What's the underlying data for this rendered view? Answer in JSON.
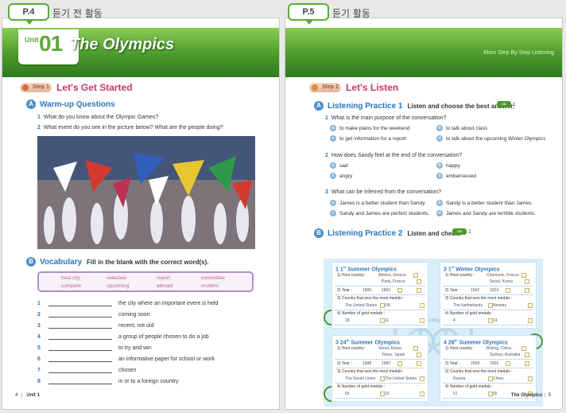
{
  "left_page": {
    "tab": "P.4",
    "tab_title": "듣기 전 활동",
    "unit_label": "Unit",
    "unit_number": "01",
    "unit_title": "The Olympics",
    "step_label": "Step 1",
    "step_title": "Let's Get Started",
    "warmup_title": "Warm-up Questions",
    "warmup_icon": "A",
    "questions": [
      {
        "num": "1",
        "text": "What do you know about the Olympic Games?"
      },
      {
        "num": "2",
        "text": "What event do you see in the picture below? What are the people doing?"
      }
    ],
    "vocab_title": "Vocabulary",
    "vocab_icon": "B",
    "vocab_instruction": "Fill in the blank with the correct word(s).",
    "vocab_words": [
      "host city",
      "selected",
      "report",
      "committee",
      "compete",
      "upcoming",
      "abroad",
      "modern"
    ],
    "fill_items": [
      {
        "num": "1",
        "meaning": "the city where an important event is held"
      },
      {
        "num": "2",
        "meaning": "coming soon"
      },
      {
        "num": "3",
        "meaning": "recent; not old"
      },
      {
        "num": "4",
        "meaning": "a group of people chosen to do a job"
      },
      {
        "num": "5",
        "meaning": "to try and win"
      },
      {
        "num": "6",
        "meaning": "an informative paper for school or work"
      },
      {
        "num": "7",
        "meaning": "chosen"
      },
      {
        "num": "8",
        "meaning": "in or to a foreign country"
      }
    ],
    "footer_page": "4",
    "footer_sep": "|",
    "footer_unit": "Unit 1"
  },
  "right_page": {
    "tab": "P.5",
    "tab_title": "듣기 활동",
    "slogan": "More Step By Step Listening",
    "step_label": "Step 2",
    "step_title": "Let's Listen",
    "lp1_title": "Listening Practice 1",
    "lp1_icon": "A",
    "lp1_instruction": "Listen and choose the best answer.",
    "lp1_cd": "CD",
    "lp1_track": "1",
    "questions": [
      {
        "num": "1",
        "text": "What is the main purpose of the conversation?",
        "options": [
          {
            "l": "a",
            "t": "to make plans for the weekend"
          },
          {
            "l": "b",
            "t": "to talk about class"
          },
          {
            "l": "c",
            "t": "to get information for a report"
          },
          {
            "l": "d",
            "t": "to talk about the upcoming Winter Olympics"
          }
        ]
      },
      {
        "num": "2",
        "text": "How does Sandy feel at the end of the conversation?",
        "options": [
          {
            "l": "a",
            "t": "sad"
          },
          {
            "l": "b",
            "t": "happy"
          },
          {
            "l": "c",
            "t": "angry"
          },
          {
            "l": "d",
            "t": "embarrassed"
          }
        ]
      },
      {
        "num": "3",
        "text": "What can be inferred from the conversation?",
        "options": [
          {
            "l": "a",
            "t": "James is a better student than Sandy."
          },
          {
            "l": "b",
            "t": "Sandy is a better student than James."
          },
          {
            "l": "c",
            "t": "Sandy and James are perfect students."
          },
          {
            "l": "d",
            "t": "James and Sandy are terrible students."
          }
        ]
      }
    ],
    "lp2_title": "Listening Practice 2",
    "lp2_icon": "B",
    "lp2_instruction": "Listen and check.",
    "lp2_cd": "CD",
    "lp2_track": "2",
    "cards": [
      {
        "num": "1",
        "sup": "st",
        "name": "Summer Olympics",
        "host_label": "1) Host country :",
        "host1": "Athens, Greece",
        "host2": "Paris, France",
        "year_label": "2) Year :",
        "year1": "1896",
        "year2": "1869",
        "won_label": "3) Country that won the most medals :",
        "won1": "The United States",
        "won2": "UK",
        "gold_label": "4) Number of gold medals :",
        "gold1": "18",
        "gold2": "11"
      },
      {
        "num": "2",
        "sup": "st",
        "name": "Winter Olympics",
        "host_label": "1) Host country :",
        "host1": "Chamonix, France",
        "host2": "Seoul, Korea",
        "year_label": "2) Year :",
        "year1": "1942",
        "year2": "1924",
        "won_label": "3) Country that won the most medals :",
        "won1": "The Netherlands",
        "won2": "Norway",
        "gold_label": "4) Number of gold medals :",
        "gold1": "4",
        "gold2": "14"
      },
      {
        "num": "3",
        "sup": "th",
        "name": "Summer Olympics",
        "host_label": "1) Host country :",
        "host1": "Seoul, Korea",
        "host2": "Tokyo, Japan",
        "year_label": "2) Year :",
        "year1": "1988",
        "year2": "1980",
        "won_label": "3) Country that won the most medals :",
        "won1": "The Soviet Union",
        "won2": "The United States",
        "gold_label": "4) Number of gold medals :",
        "gold1": "55",
        "gold2": "15"
      },
      {
        "num": "4",
        "sup": "th",
        "name": "Summer Olympics",
        "host_label": "1) Host country :",
        "host1": "Beijing, China",
        "host2": "Sydney, Australia",
        "year_label": "2) Year :",
        "year1": "2008",
        "year2": "2006",
        "won_label": "3) Country that won the most medals :",
        "won1": "Russia",
        "won2": "China",
        "gold_label": "4) Number of gold medals :",
        "gold1": "51",
        "gold2": "55"
      }
    ],
    "card_prefix": [
      "1",
      "1",
      "24",
      "29"
    ],
    "footer_title": "The Olympics",
    "footer_sep": "|",
    "footer_page": "5"
  },
  "colors": {
    "green": "#5cab3c",
    "blue": "#2a77b8",
    "pink": "#c8385f",
    "lightblue": "#d9eef9"
  }
}
